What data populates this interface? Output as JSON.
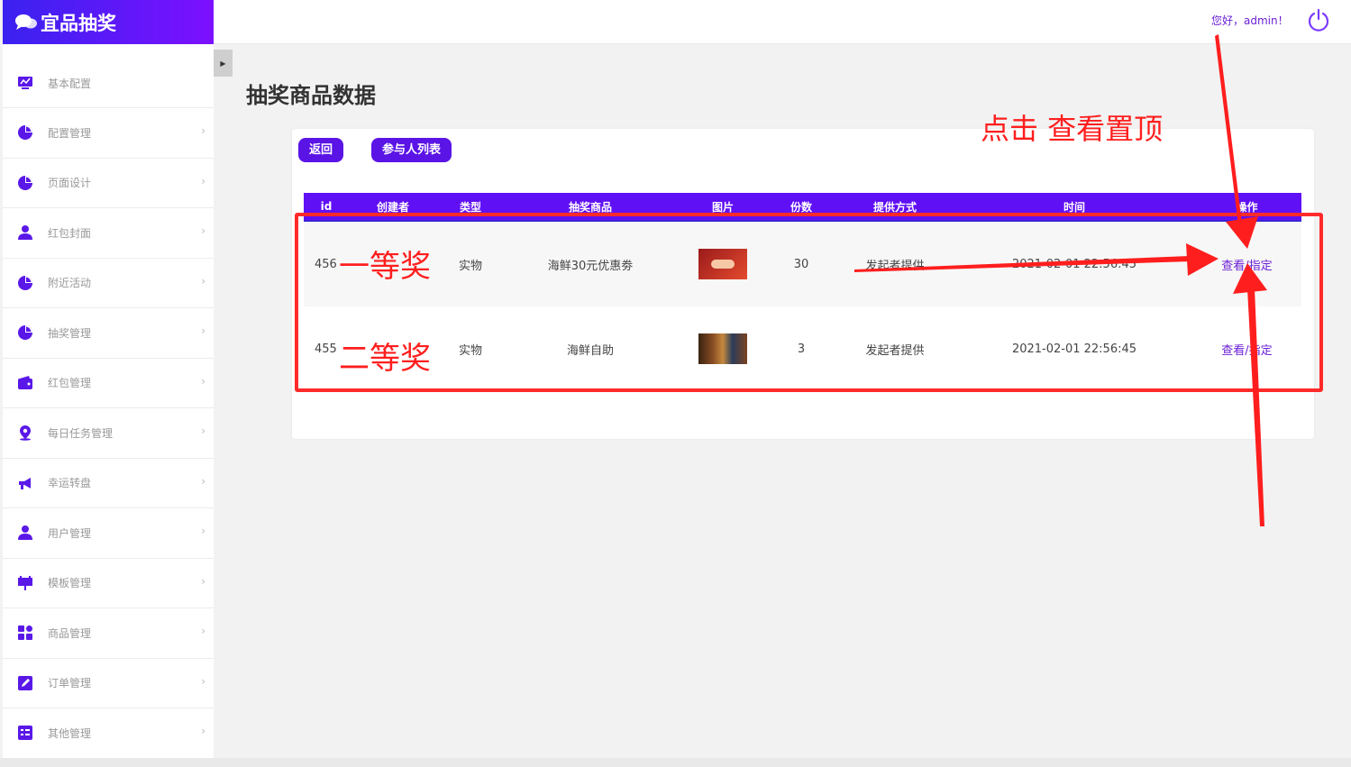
{
  "app": {
    "title": "宜品抽奖"
  },
  "header": {
    "greeting": "您好，admin！"
  },
  "sidebar": {
    "items": [
      {
        "label": "基本配置",
        "icon": "monitor-chart-icon",
        "has_chevron": false
      },
      {
        "label": "配置管理",
        "icon": "pie-chart-icon",
        "has_chevron": true
      },
      {
        "label": "页面设计",
        "icon": "pie-chart-icon",
        "has_chevron": true
      },
      {
        "label": "红包封面",
        "icon": "user-icon",
        "has_chevron": true
      },
      {
        "label": "附近活动",
        "icon": "pie-chart-icon",
        "has_chevron": true
      },
      {
        "label": "抽奖管理",
        "icon": "pie-chart-icon",
        "has_chevron": true
      },
      {
        "label": "红包管理",
        "icon": "wallet-icon",
        "has_chevron": true
      },
      {
        "label": "每日任务管理",
        "icon": "location-pin-icon",
        "has_chevron": true
      },
      {
        "label": "幸运转盘",
        "icon": "megaphone-icon",
        "has_chevron": true
      },
      {
        "label": "用户管理",
        "icon": "user-icon",
        "has_chevron": true
      },
      {
        "label": "模板管理",
        "icon": "board-icon",
        "has_chevron": true
      },
      {
        "label": "商品管理",
        "icon": "grid-apps-icon",
        "has_chevron": true
      },
      {
        "label": "订单管理",
        "icon": "edit-icon",
        "has_chevron": true
      },
      {
        "label": "其他管理",
        "icon": "list-icon",
        "has_chevron": true
      }
    ]
  },
  "page": {
    "title": "抽奖商品数据"
  },
  "buttons": {
    "back": "返回",
    "participants": "参与人列表"
  },
  "table": {
    "columns": [
      "id",
      "创建者",
      "类型",
      "抽奖商品",
      "图片",
      "份数",
      "提供方式",
      "时间",
      "操作"
    ],
    "rows": [
      {
        "id": "456",
        "creator": "",
        "type": "实物",
        "product": "海鲜30元优惠劵",
        "image": "coupon-thumbnail",
        "count": "30",
        "provider": "发起者提供",
        "time": "2021-02-01 22:56:45",
        "action": "查看/指定"
      },
      {
        "id": "455",
        "creator": "",
        "type": "实物",
        "product": "海鲜自助",
        "image": "seafood-thumbnail",
        "count": "3",
        "provider": "发起者提供",
        "time": "2021-02-01 22:56:45",
        "action": "查看/指定"
      }
    ]
  },
  "annotations": {
    "click_hint": "点击 查看置顶",
    "first_prize": "一等奖",
    "second_prize": "二等奖",
    "color": "#ff1e1e"
  },
  "colors": {
    "brand_start": "#3a22f0",
    "brand_end": "#7c10ff",
    "accent": "#6010f4",
    "link": "#6a1fd6"
  }
}
